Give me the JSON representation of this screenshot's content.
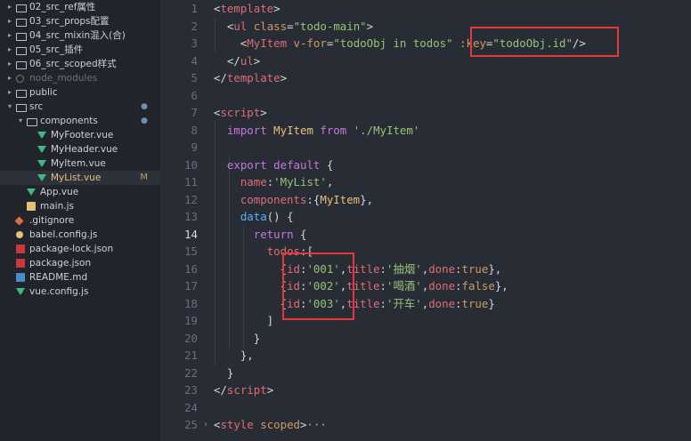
{
  "explorer": {
    "items": [
      {
        "label": "02_src_ref属性",
        "kind": "folder",
        "state": "closed",
        "indent": 0
      },
      {
        "label": "03_src_props配置",
        "kind": "folder",
        "state": "closed",
        "indent": 0
      },
      {
        "label": "04_src_mixin混入(合)",
        "kind": "folder",
        "state": "closed",
        "indent": 0
      },
      {
        "label": "05_src_插件",
        "kind": "folder",
        "state": "closed",
        "indent": 0
      },
      {
        "label": "06_src_scoped样式",
        "kind": "folder",
        "state": "closed",
        "indent": 0
      },
      {
        "label": "node_modules",
        "kind": "node",
        "state": "closed",
        "indent": 0,
        "dim": true
      },
      {
        "label": "public",
        "kind": "folder",
        "state": "closed",
        "indent": 0
      },
      {
        "label": "src",
        "kind": "folder",
        "state": "open",
        "indent": 0,
        "badge": "●"
      },
      {
        "label": "components",
        "kind": "folder",
        "state": "open",
        "indent": 1,
        "badge": "●"
      },
      {
        "label": "MyFooter.vue",
        "kind": "vue",
        "indent": 2
      },
      {
        "label": "MyHeader.vue",
        "kind": "vue",
        "indent": 2
      },
      {
        "label": "MyItem.vue",
        "kind": "vue",
        "indent": 2
      },
      {
        "label": "MyList.vue",
        "kind": "vue",
        "indent": 2,
        "selected": true,
        "mark": "M"
      },
      {
        "label": "App.vue",
        "kind": "vue",
        "indent": 1
      },
      {
        "label": "main.js",
        "kind": "js",
        "indent": 1
      },
      {
        "label": ".gitignore",
        "kind": "git",
        "indent": 0
      },
      {
        "label": "babel.config.js",
        "kind": "babel",
        "indent": 0
      },
      {
        "label": "package-lock.json",
        "kind": "npm",
        "indent": 0
      },
      {
        "label": "package.json",
        "kind": "npm",
        "indent": 0
      },
      {
        "label": "README.md",
        "kind": "md",
        "indent": 0
      },
      {
        "label": "vue.config.js",
        "kind": "vue",
        "indent": 0
      }
    ]
  },
  "editor": {
    "active_line": 14,
    "lines": [
      {
        "n": "1",
        "tokens": [
          [
            "<",
            "punct"
          ],
          [
            "template",
            "tag"
          ],
          [
            ">",
            "punct"
          ]
        ]
      },
      {
        "n": "2",
        "tokens": [
          [
            "  <",
            "punct"
          ],
          [
            "ul",
            "tag"
          ],
          [
            " ",
            "plain"
          ],
          [
            "class",
            "attr"
          ],
          [
            "=",
            "punct"
          ],
          [
            "\"todo-main\"",
            "str"
          ],
          [
            ">",
            "punct"
          ]
        ]
      },
      {
        "n": "3",
        "tokens": [
          [
            "    <",
            "punct"
          ],
          [
            "MyItem",
            "tag"
          ],
          [
            " ",
            "plain"
          ],
          [
            "v-for",
            "attr"
          ],
          [
            "=",
            "punct"
          ],
          [
            "\"todoObj in todos\"",
            "str"
          ],
          [
            " ",
            "plain"
          ],
          [
            ":key",
            "attr"
          ],
          [
            "=",
            "punct"
          ],
          [
            "\"todoObj.id\"",
            "str"
          ],
          [
            "/>",
            "punct"
          ]
        ]
      },
      {
        "n": "4",
        "tokens": [
          [
            "  </",
            "punct"
          ],
          [
            "ul",
            "tag"
          ],
          [
            ">",
            "punct"
          ]
        ]
      },
      {
        "n": "5",
        "tokens": [
          [
            "</",
            "punct"
          ],
          [
            "template",
            "tag"
          ],
          [
            ">",
            "punct"
          ]
        ]
      },
      {
        "n": "6",
        "tokens": []
      },
      {
        "n": "7",
        "tokens": [
          [
            "<",
            "punct"
          ],
          [
            "script",
            "tag"
          ],
          [
            ">",
            "punct"
          ]
        ]
      },
      {
        "n": "8",
        "tokens": [
          [
            "  ",
            "plain"
          ],
          [
            "import",
            "kw"
          ],
          [
            " ",
            "plain"
          ],
          [
            "MyItem",
            "comp"
          ],
          [
            " ",
            "plain"
          ],
          [
            "from",
            "kw"
          ],
          [
            " ",
            "plain"
          ],
          [
            "'./MyItem'",
            "str"
          ]
        ]
      },
      {
        "n": "9",
        "tokens": []
      },
      {
        "n": "10",
        "tokens": [
          [
            "  ",
            "plain"
          ],
          [
            "export",
            "kw"
          ],
          [
            " ",
            "plain"
          ],
          [
            "default",
            "kw"
          ],
          [
            " {",
            "punct"
          ]
        ]
      },
      {
        "n": "11",
        "tokens": [
          [
            "    ",
            "plain"
          ],
          [
            "name",
            "prop"
          ],
          [
            ":",
            "punct"
          ],
          [
            "'MyList'",
            "str"
          ],
          [
            ",",
            "punct"
          ]
        ]
      },
      {
        "n": "12",
        "tokens": [
          [
            "    ",
            "plain"
          ],
          [
            "components",
            "prop"
          ],
          [
            ":{",
            "punct"
          ],
          [
            "MyItem",
            "comp"
          ],
          [
            "},",
            "punct"
          ]
        ]
      },
      {
        "n": "13",
        "tokens": [
          [
            "    ",
            "plain"
          ],
          [
            "data",
            "fn"
          ],
          [
            "() {",
            "punct"
          ]
        ]
      },
      {
        "n": "14",
        "tokens": [
          [
            "      ",
            "plain"
          ],
          [
            "return",
            "kw"
          ],
          [
            " {",
            "punct"
          ]
        ]
      },
      {
        "n": "15",
        "tokens": [
          [
            "        ",
            "plain"
          ],
          [
            "todos",
            "prop"
          ],
          [
            ":[",
            "punct"
          ]
        ]
      },
      {
        "n": "16",
        "tokens": [
          [
            "          {",
            "punct"
          ],
          [
            "id",
            "prop"
          ],
          [
            ":",
            "punct"
          ],
          [
            "'001'",
            "str"
          ],
          [
            ",",
            "punct"
          ],
          [
            "title",
            "prop"
          ],
          [
            ":",
            "punct"
          ],
          [
            "'抽烟'",
            "str"
          ],
          [
            ",",
            "punct"
          ],
          [
            "done",
            "prop"
          ],
          [
            ":",
            "punct"
          ],
          [
            "true",
            "const"
          ],
          [
            "},",
            "punct"
          ]
        ]
      },
      {
        "n": "17",
        "tokens": [
          [
            "          {",
            "punct"
          ],
          [
            "id",
            "prop"
          ],
          [
            ":",
            "punct"
          ],
          [
            "'002'",
            "str"
          ],
          [
            ",",
            "punct"
          ],
          [
            "title",
            "prop"
          ],
          [
            ":",
            "punct"
          ],
          [
            "'喝酒'",
            "str"
          ],
          [
            ",",
            "punct"
          ],
          [
            "done",
            "prop"
          ],
          [
            ":",
            "punct"
          ],
          [
            "false",
            "const"
          ],
          [
            "},",
            "punct"
          ]
        ]
      },
      {
        "n": "18",
        "tokens": [
          [
            "          {",
            "punct"
          ],
          [
            "id",
            "prop"
          ],
          [
            ":",
            "punct"
          ],
          [
            "'003'",
            "str"
          ],
          [
            ",",
            "punct"
          ],
          [
            "title",
            "prop"
          ],
          [
            ":",
            "punct"
          ],
          [
            "'开车'",
            "str"
          ],
          [
            ",",
            "punct"
          ],
          [
            "done",
            "prop"
          ],
          [
            ":",
            "punct"
          ],
          [
            "true",
            "const"
          ],
          [
            "}",
            "punct"
          ]
        ]
      },
      {
        "n": "19",
        "tokens": [
          [
            "        ]",
            "punct"
          ]
        ]
      },
      {
        "n": "20",
        "tokens": [
          [
            "      }",
            "punct"
          ]
        ]
      },
      {
        "n": "21",
        "tokens": [
          [
            "    },",
            "punct"
          ]
        ]
      },
      {
        "n": "22",
        "tokens": [
          [
            "  }",
            "punct"
          ]
        ]
      },
      {
        "n": "23",
        "tokens": [
          [
            "</",
            "punct"
          ],
          [
            "script",
            "tag"
          ],
          [
            ">",
            "punct"
          ]
        ]
      },
      {
        "n": "24",
        "tokens": []
      },
      {
        "n": "25",
        "tokens": [
          [
            "<",
            "punct"
          ],
          [
            "style",
            "tag"
          ],
          [
            " ",
            "plain"
          ],
          [
            "scoped",
            "attr"
          ],
          [
            ">",
            "punct"
          ],
          [
            "···",
            "plain"
          ]
        ]
      }
    ],
    "fold_marker": "›"
  },
  "colors": {
    "sidebar_bg": "#21252b",
    "editor_bg": "#282c34",
    "highlight_box": "#e5383b"
  }
}
